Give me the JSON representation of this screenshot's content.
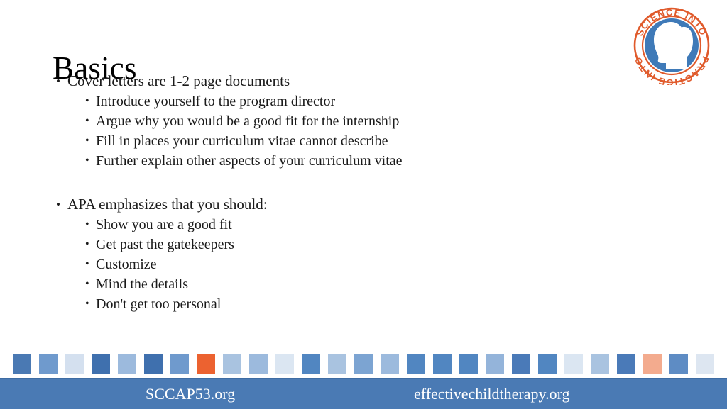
{
  "slide": {
    "title": "Basics",
    "background_color": "#ffffff",
    "text_color": "#1a1a1a"
  },
  "logo": {
    "name": "science-into-practice-logo",
    "ring_text_top": "SCIENCE INTO",
    "ring_text_bottom": "PRACTICE INTO",
    "ring_text_color": "#e05a2b",
    "disc_color": "#3f7ab8",
    "face_color": "#ffffff"
  },
  "content": {
    "blocks": [
      {
        "lead": "Cover letters are 1-2 page documents",
        "subs": [
          "Introduce yourself to the program director",
          "Argue why you would be a good fit for the internship",
          "Fill in places your curriculum vitae cannot describe",
          "Further explain other aspects of your curriculum vitae"
        ]
      },
      {
        "lead": "APA emphasizes that you should:",
        "subs": [
          "Show you are a good fit",
          "Get past the gatekeepers",
          "Customize",
          "Mind the details",
          "Don't get too personal"
        ]
      }
    ],
    "bullet_glyph": "•"
  },
  "decor_band": {
    "square_count": 27,
    "colors": [
      "#4a79b3",
      "#6f9acd",
      "#d4e0ef",
      "#3f70ae",
      "#9cbadd",
      "#3f70ae",
      "#6f9acd",
      "#ec6230",
      "#a9c3e0",
      "#9cbadd",
      "#dbe6f2",
      "#5186c1",
      "#a9c3e0",
      "#7ca4d2",
      "#9cbadd",
      "#5186c1",
      "#5186c1",
      "#5186c1",
      "#94b4da",
      "#4a7ab8",
      "#5186c1",
      "#dbe6f2",
      "#a9c3e0",
      "#4a7ab8",
      "#f3ab8e",
      "#5e8cc4",
      "#dde6f1"
    ]
  },
  "footer": {
    "bar_color": "#4a7ab4",
    "left_text": "SCCAP53.org",
    "right_text": "effectivechildtherapy.org",
    "text_color": "#ffffff"
  }
}
